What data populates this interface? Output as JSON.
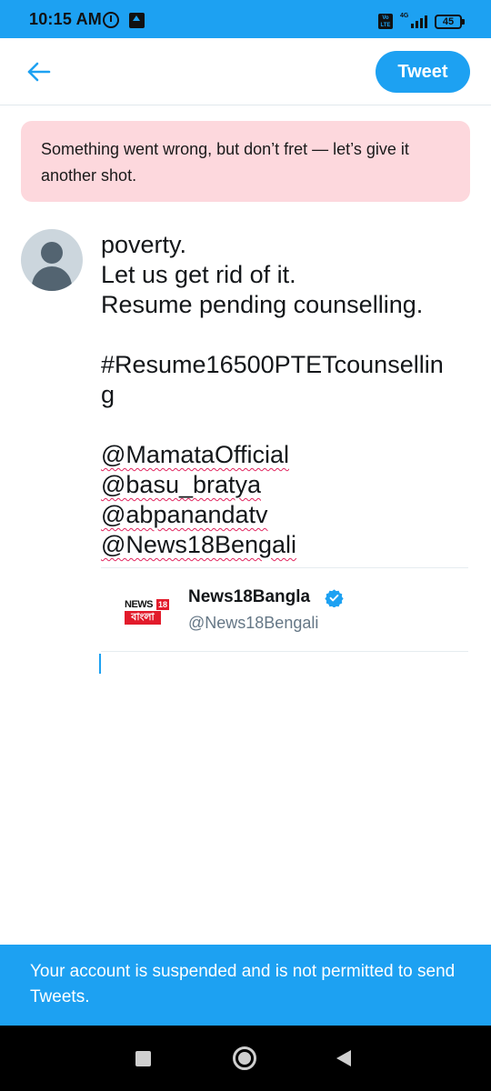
{
  "status_bar": {
    "time": "10:15 AM",
    "volte_label": "Vo LTE",
    "network_label": "4G",
    "battery_level": "45",
    "icons": [
      "alarm-icon",
      "upload-icon",
      "volte-icon",
      "signal-icon",
      "battery-icon"
    ]
  },
  "header": {
    "back_icon": "back-arrow-icon",
    "tweet_button": "Tweet"
  },
  "error_banner": {
    "message": "Something went wrong, but don’t fret — let’s give it another shot."
  },
  "compose": {
    "avatar_icon": "default-avatar-icon",
    "lines": {
      "l1": "poverty.",
      "l2": "Let us get rid of it.",
      "l3": "Resume pending counselling.",
      "l4": "#Resume16500PTETcounsellin",
      "l5": "g",
      "m1": "@MamataOfficial",
      "m2": "@basu_bratya",
      "m3": "@abpanandatv",
      "m4": "@News18Bengali"
    }
  },
  "suggestion": {
    "name": "News18Bangla",
    "handle": "@News18Bengali",
    "verified": true,
    "logo_text_top": "NEWS",
    "logo_number": "18",
    "logo_text_bottom": "বাংলা"
  },
  "footer_notice": {
    "message": "Your account is suspended and is not permitted to send Tweets."
  },
  "nav_bar": {
    "icons": [
      "recents-square-icon",
      "home-circle-icon",
      "back-triangle-icon"
    ]
  },
  "colors": {
    "accent": "#1da1f2",
    "error_bg": "#fdd8dd",
    "misspell_underline": "#e0245e"
  }
}
